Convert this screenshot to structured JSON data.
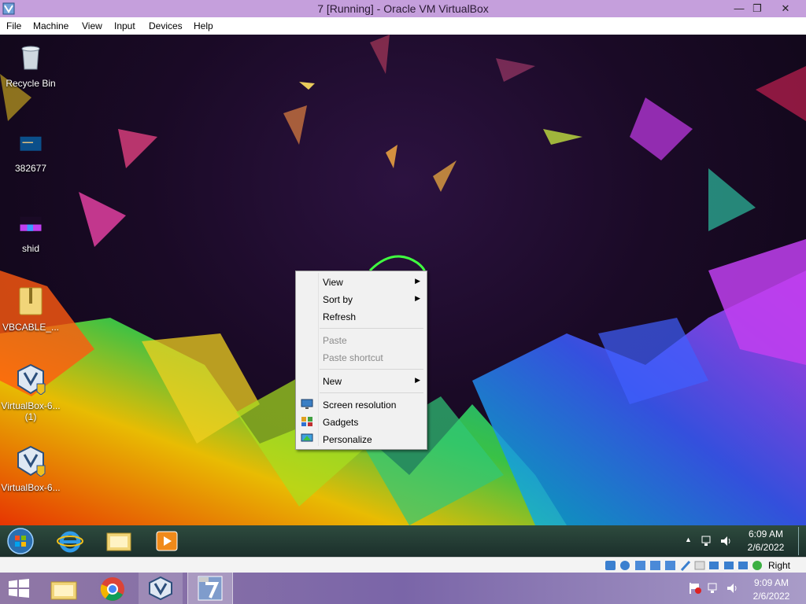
{
  "window": {
    "title": "7 [Running] - Oracle VM VirtualBox"
  },
  "menu": {
    "file": "File",
    "machine": "Machine",
    "view": "View",
    "input": "Input",
    "devices": "Devices",
    "help": "Help"
  },
  "desktop_icons": [
    {
      "label": "Recycle Bin",
      "icon": "recycle-bin-icon"
    },
    {
      "label": "382677",
      "icon": "image-file-icon"
    },
    {
      "label": "shid",
      "icon": "image-file-icon"
    },
    {
      "label": "VBCABLE_...",
      "icon": "zip-folder-icon"
    },
    {
      "label": "VirtualBox-6...",
      "label2": "(1)",
      "icon": "virtualbox-installer-icon"
    },
    {
      "label": "VirtualBox-6...",
      "icon": "virtualbox-installer-icon"
    }
  ],
  "context_menu": {
    "view": "View",
    "sort_by": "Sort by",
    "refresh": "Refresh",
    "paste": "Paste",
    "paste_shortcut": "Paste shortcut",
    "new": "New",
    "screen_resolution": "Screen resolution",
    "gadgets": "Gadgets",
    "personalize": "Personalize",
    "arrow": "▶"
  },
  "guest_clock": {
    "time": "6:09 AM",
    "date": "2/6/2022"
  },
  "host_clock": {
    "time": "9:09 AM",
    "date": "2/6/2022"
  },
  "statusbar": {
    "host_key": "Right Ctrl"
  },
  "glyphs": {
    "restore": "❐",
    "close": "✕",
    "minimize": "—",
    "tray_up": "▲"
  }
}
